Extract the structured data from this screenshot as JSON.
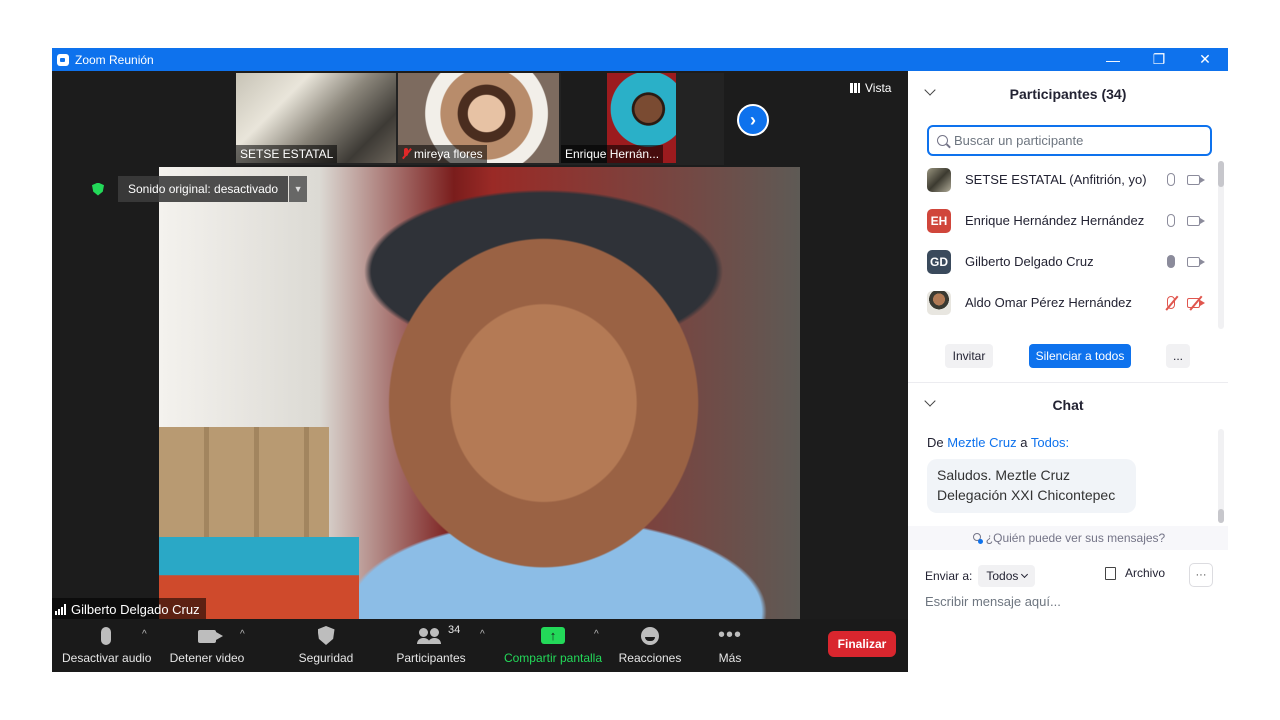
{
  "window": {
    "title": "Zoom Reunión",
    "controls": [
      "—",
      "❐",
      "✕"
    ]
  },
  "thumbnails": [
    {
      "name": "SETSE ESTATAL",
      "muted": false
    },
    {
      "name": "mireya flores",
      "muted": true
    },
    {
      "name": "Enrique Hernán...",
      "muted": false
    }
  ],
  "view_button": {
    "label": "Vista"
  },
  "sound_original": {
    "label": "Sonido original: desactivado"
  },
  "active_speaker": {
    "name": "Gilberto  Delgado Cruz"
  },
  "toolbar": {
    "mute": "Desactivar audio",
    "video": "Detener video",
    "security": "Seguridad",
    "participants": "Participantes",
    "participants_count": "34",
    "share": "Compartir pantalla",
    "reactions": "Reacciones",
    "more": "Más",
    "end": "Finalizar"
  },
  "participants_panel": {
    "title": "Participantes (34)",
    "search_placeholder": "Buscar un participante",
    "participants": [
      {
        "name": "SETSE ESTATAL (Anfitrión, yo)",
        "initials": "",
        "avatar_color": "#6b6a5c",
        "muted": false,
        "video_off": false
      },
      {
        "name": "Enrique Hernández Hernández",
        "initials": "EH",
        "avatar_color": "#d0463b",
        "muted": false,
        "video_off": false
      },
      {
        "name": "Gilberto  Delgado Cruz",
        "initials": "GD",
        "avatar_color": "#3a4a5c",
        "muted": false,
        "video_off": false
      },
      {
        "name": "Aldo Omar Pérez Hernández",
        "initials": "",
        "avatar_color": "#8a6a4a",
        "muted": true,
        "video_off": true
      }
    ],
    "invite": "Invitar",
    "mute_all": "Silenciar a todos",
    "more": "..."
  },
  "chat": {
    "title": "Chat",
    "from_prefix": "De",
    "from": "Meztle Cruz",
    "to_prefix": "a",
    "to": "Todos:",
    "message_line1": "Saludos. Meztle Cruz",
    "message_line2": "Delegación XXI Chicontepec",
    "who_sees": "¿Quién puede ver sus mensajes?",
    "send_to_label": "Enviar a:",
    "send_to_value": "Todos",
    "file": "Archivo",
    "more": "···",
    "input_placeholder": "Escribir mensaje aquí..."
  }
}
